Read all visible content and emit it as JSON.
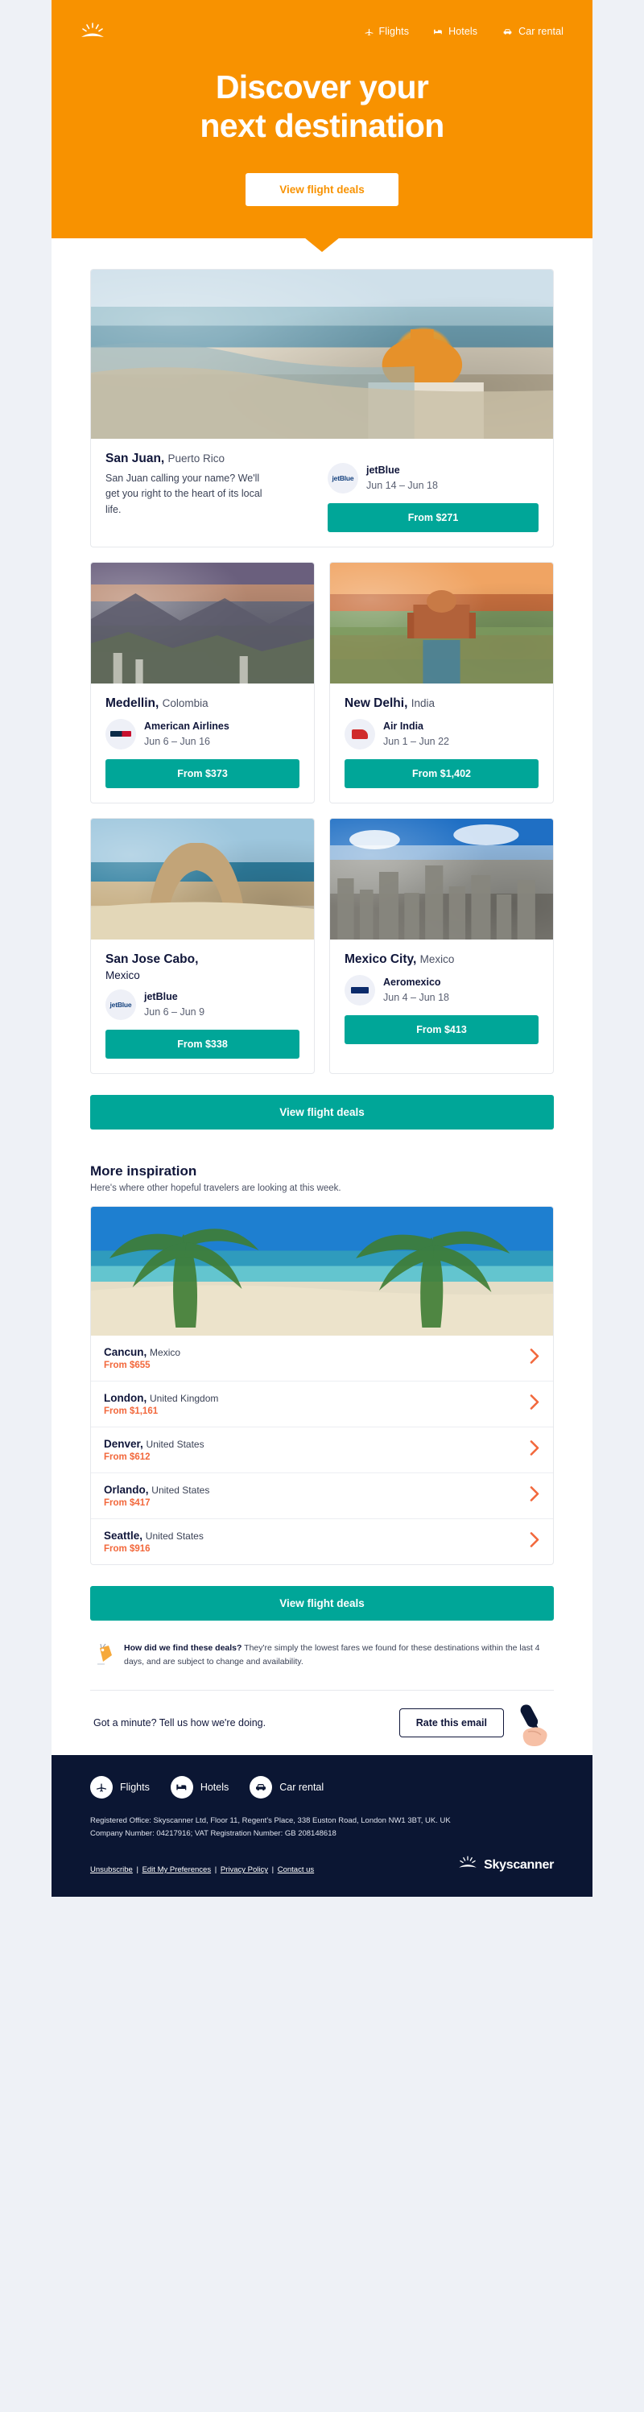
{
  "hero": {
    "logo_icon": "skyscanner-sun-icon",
    "nav": [
      {
        "label": "Flights",
        "icon": "plane-icon"
      },
      {
        "label": "Hotels",
        "icon": "bed-icon"
      },
      {
        "label": "Car rental",
        "icon": "car-icon"
      }
    ],
    "title_line1": "Discover your",
    "title_line2": "next destination",
    "cta_label": "View flight deals",
    "background_color": "#f89200"
  },
  "featured": {
    "primary": {
      "city": "San Juan,",
      "country": "Puerto Rico",
      "blurb": "San Juan calling your name? We'll get you right to the heart of its local life.",
      "airline": "jetBlue",
      "airline_logo": "jetblue-logo",
      "dates": "Jun 14 – Jun 18",
      "price_label": "From $271",
      "photo": "san-juan-coast-photo"
    },
    "cards": [
      {
        "city": "Medellin,",
        "country": "Colombia",
        "country_inline": true,
        "airline": "American Airlines",
        "airline_logo": "american-airlines-logo",
        "dates": "Jun 6 – Jun 16",
        "price_label": "From $373",
        "photo": "medellin-mountains-photo"
      },
      {
        "city": "New Delhi,",
        "country": "India",
        "country_inline": true,
        "airline": "Air India",
        "airline_logo": "air-india-logo",
        "dates": "Jun 1 – Jun 22",
        "price_label": "From $1,402",
        "photo": "new-delhi-monument-photo"
      },
      {
        "city": "San Jose Cabo,",
        "country": "Mexico",
        "country_inline": false,
        "airline": "jetBlue",
        "airline_logo": "jetblue-logo",
        "dates": "Jun 6 – Jun 9",
        "price_label": "From $338",
        "photo": "cabo-arch-photo"
      },
      {
        "city": "Mexico City,",
        "country": "Mexico",
        "country_inline": true,
        "airline": "Aeromexico",
        "airline_logo": "aeromexico-logo",
        "dates": "Jun 4 – Jun 18",
        "price_label": "From $413",
        "photo": "mexico-city-skyline-photo"
      }
    ],
    "cta_label": "View flight deals",
    "cta_color": "#00a698"
  },
  "inspiration": {
    "title": "More inspiration",
    "subtitle": "Here's where other hopeful travelers are looking at this week.",
    "photo": "palm-trees-beach-photo",
    "rows": [
      {
        "city": "Cancun,",
        "country": "Mexico",
        "price": "From $655"
      },
      {
        "city": "London,",
        "country": "United Kingdom",
        "price": "From $1,161"
      },
      {
        "city": "Denver,",
        "country": "United States",
        "price": "From $612"
      },
      {
        "city": "Orlando,",
        "country": "United States",
        "price": "From $417"
      },
      {
        "city": "Seattle,",
        "country": "United States",
        "price": "From $916"
      }
    ],
    "price_color": "#f2683c",
    "cta_label": "View flight deals"
  },
  "disclaimer": {
    "icon": "price-tag-icon",
    "lead": "How did we find these deals?",
    "text": " They're simply the lowest fares we found for these destinations within the last 4 days, and are subject to change and availability."
  },
  "rate": {
    "prompt": "Got a minute? Tell us how we're doing.",
    "button_label": "Rate this email",
    "art_icon": "microphone-hand-icon"
  },
  "footer": {
    "background_color": "#0b1633",
    "nav": [
      {
        "label": "Flights",
        "icon": "plane-icon"
      },
      {
        "label": "Hotels",
        "icon": "bed-icon"
      },
      {
        "label": "Car rental",
        "icon": "car-icon"
      }
    ],
    "legal_line1": "Registered Office: Skyscanner Ltd, Floor 11, Regent's Place, 338 Euston Road, London NW1 3BT, UK. UK",
    "legal_line2": "Company Number: 04217916; VAT Registration Number: GB 208148618",
    "links": [
      "Unsubscribe",
      "Edit My Preferences",
      "Privacy Policy",
      "Contact us"
    ],
    "brand_name": "Skyscanner",
    "brand_icon": "skyscanner-sun-icon"
  }
}
